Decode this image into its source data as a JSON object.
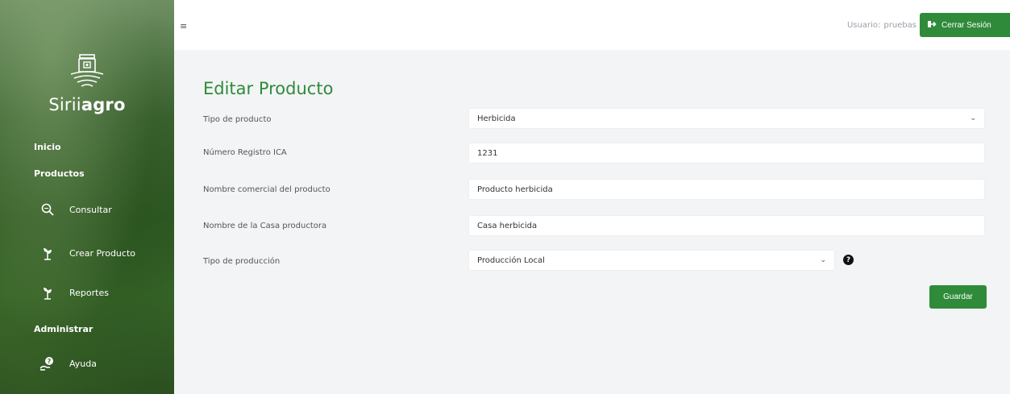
{
  "sidebar": {
    "brand": {
      "light": "Sirii",
      "bold": "agro"
    },
    "sections": {
      "inicio": "Inicio",
      "productos": "Productos",
      "administrar": "Administrar"
    },
    "items": [
      {
        "label": "Consultar",
        "icon": "search-icon"
      },
      {
        "label": "Crear Producto",
        "icon": "plant-icon"
      },
      {
        "label": "Reportes",
        "icon": "plant-icon"
      },
      {
        "label": "Ayuda",
        "icon": "help-hand-icon"
      }
    ]
  },
  "topbar": {
    "menu_glyph": "≡",
    "user_prefix": "Usuario:",
    "user_name": "pruebas",
    "logout_label": "Cerrar Sesión"
  },
  "form": {
    "title": "Editar Producto",
    "fields": [
      {
        "label": "Tipo de producto",
        "value": "Herbicida"
      },
      {
        "label": "Número Registro ICA",
        "value": "1231"
      },
      {
        "label": "Nombre comercial del producto",
        "value": "Producto herbicida"
      },
      {
        "label": "Nombre de la Casa productora",
        "value": "Casa herbicida"
      },
      {
        "label": "Tipo de producción",
        "value": "Producción Local"
      }
    ],
    "help_glyph": "?",
    "save_label": "Guardar"
  },
  "colors": {
    "accent": "#2f8b3a",
    "sidebar": "#3d6531"
  }
}
